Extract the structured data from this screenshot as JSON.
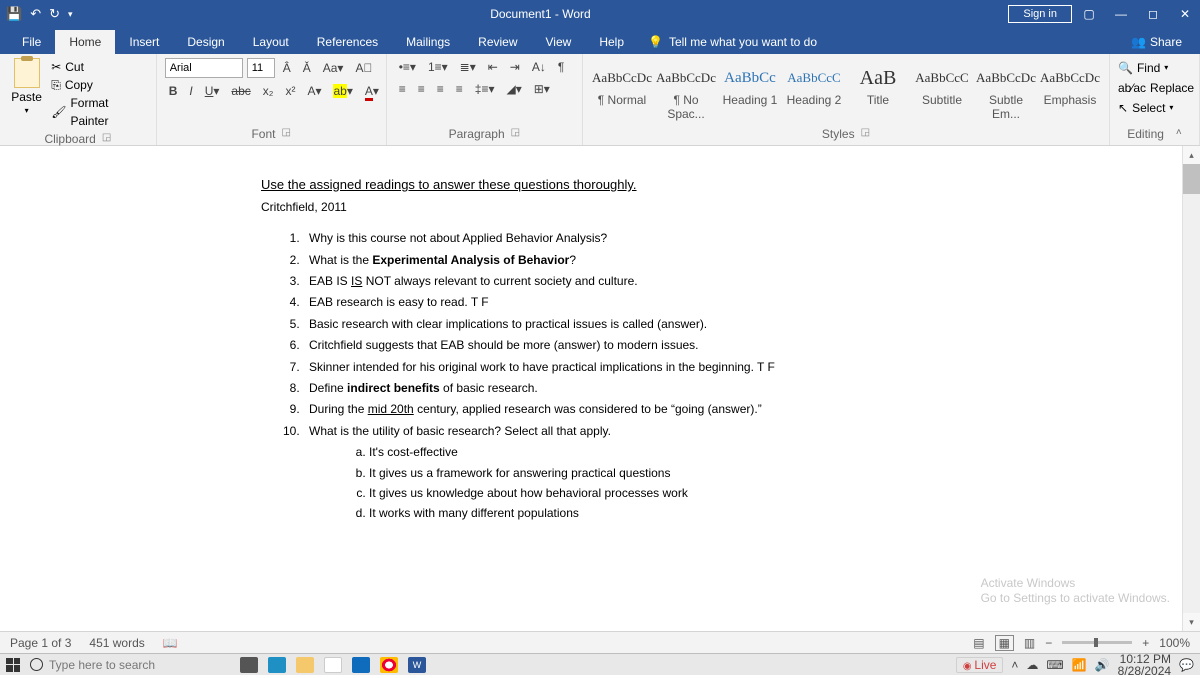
{
  "titlebar": {
    "title": "Document1 - Word",
    "signin": "Sign in"
  },
  "tabs": [
    "File",
    "Home",
    "Insert",
    "Design",
    "Layout",
    "References",
    "Mailings",
    "Review",
    "View",
    "Help"
  ],
  "tell": "Tell me what you want to do",
  "share": "Share",
  "clipboard": {
    "paste": "Paste",
    "cut": "Cut",
    "copy": "Copy",
    "painter": "Format Painter",
    "label": "Clipboard"
  },
  "font": {
    "name": "Arial",
    "size": "11",
    "label": "Font"
  },
  "paragraph": {
    "label": "Paragraph"
  },
  "styles": {
    "label": "Styles",
    "items": [
      {
        "prev": "AaBbCcDc",
        "name": "¶ Normal"
      },
      {
        "prev": "AaBbCcDc",
        "name": "¶ No Spac..."
      },
      {
        "prev": "AaBbCc",
        "name": "Heading 1",
        "cls": "h1"
      },
      {
        "prev": "AaBbCcC",
        "name": "Heading 2",
        "cls": "h2"
      },
      {
        "prev": "AaB",
        "name": "Title",
        "cls": "title"
      },
      {
        "prev": "AaBbCcC",
        "name": "Subtitle"
      },
      {
        "prev": "AaBbCcDc",
        "name": "Subtle Em..."
      },
      {
        "prev": "AaBbCcDc",
        "name": "Emphasis"
      }
    ]
  },
  "editing": {
    "find": "Find",
    "replace": "Replace",
    "select": "Select",
    "label": "Editing"
  },
  "doc": {
    "intro": "Use the assigned readings to answer these questions thoroughly.",
    "ref": "Critchfield, 2011",
    "q1": "Why is this course not about Applied Behavior Analysis?",
    "q2a": "What is the ",
    "q2b": "Experimental Analysis of Behavior",
    "q2c": "?",
    "q3a": "EAB IS ",
    "q3b": "IS",
    "q3c": " NOT always relevant to current society and culture.",
    "q4": "EAB research is easy to read.  T   F",
    "q5": "Basic research with clear implications to practical issues is called (answer).",
    "q6": "Critchfield suggests that EAB should be more (answer) to modern issues.",
    "q7": "Skinner intended for his original work to have practical implications in the beginning.  T   F",
    "q8a": "Define ",
    "q8b": "indirect benefits",
    "q8c": " of basic research.",
    "q9a": "During the ",
    "q9b": "mid 20th",
    "q9c": " century, applied research was considered to be “going (answer).”",
    "q10": "What is the utility of basic research?  Select all that apply.",
    "a": "It's cost-effective",
    "b": "It gives us a framework for answering practical questions",
    "c": "It gives us knowledge about how behavioral processes work",
    "d": "It works with many different populations"
  },
  "watermark": {
    "l1": "Activate Windows",
    "l2": "Go to Settings to activate Windows."
  },
  "status": {
    "page": "Page 1 of 3",
    "words": "451 words",
    "zoom": "100%"
  },
  "taskbar": {
    "search": "Type here to search",
    "live": "Live",
    "time": "10:12 PM",
    "date": "8/28/2024"
  }
}
